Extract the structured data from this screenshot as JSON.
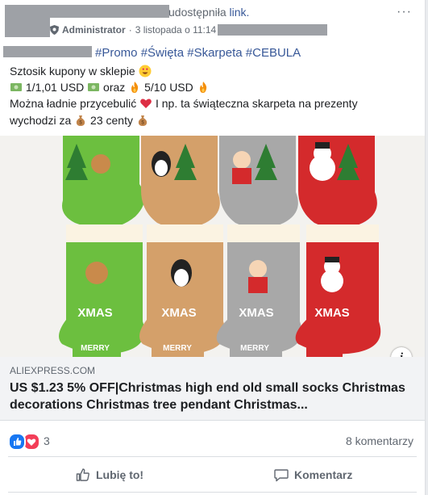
{
  "header": {
    "shared_text": "udostępniła",
    "shared_link": "link.",
    "role": "Administrator",
    "timestamp": "3 listopada o 11:14",
    "more_label": "···"
  },
  "post": {
    "hashtags": "#Promo #Święta #Skarpeta #CEBULA",
    "line1": "Sztosik kupony w sklepie",
    "line2a": "1/1,01 USD",
    "line2b": "oraz",
    "line2c": "5/10 USD",
    "line3a": "Można ładnie przycebulić",
    "line3b": "I np. ta świąteczna skarpeta na prezenty",
    "line4a": "wychodzi za",
    "line4b": "23 centy"
  },
  "image": {
    "info_label": "i",
    "sock_labels": [
      "XMAS",
      "XMAS",
      "XMAS",
      "XMAS",
      "MERRY",
      "MERRY",
      "MERRY"
    ],
    "colors": {
      "green": "#6cbf3f",
      "tan": "#d4a06a",
      "gray": "#a8a8a8",
      "red": "#d42a2c"
    }
  },
  "link_preview": {
    "domain": "ALIEXPRESS.COM",
    "title": "US $1.23 5% OFF|Christmas high end old small socks Christmas decorations Christmas tree pendant Christmas..."
  },
  "reactions": {
    "count": "3",
    "comments": "8 komentarzy",
    "like_color": "#1877f2",
    "love_color": "#f33e58"
  },
  "actions": {
    "like": "Lubię to!",
    "comment": "Komentarz"
  }
}
